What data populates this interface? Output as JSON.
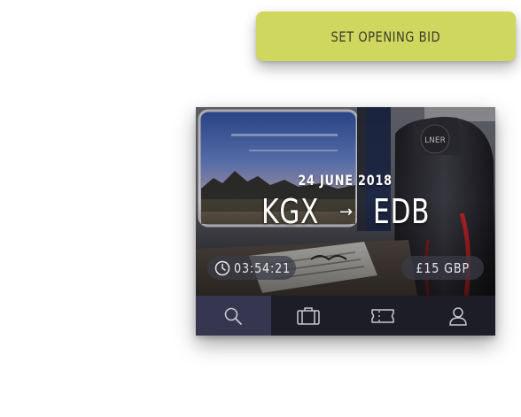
{
  "cta": {
    "label": "SET OPENING BID",
    "color": "#cfd75e"
  },
  "ticket": {
    "date": "24 JUNE 2018",
    "origin": "KGX",
    "destination": "EDB",
    "arrow": "→",
    "time_remaining": "03:54:21",
    "price": "£15 GBP",
    "seat_brand": "LNER"
  },
  "tabbar": {
    "active_tab": "search",
    "tabs": [
      {
        "id": "search",
        "icon": "search-icon"
      },
      {
        "id": "luggage",
        "icon": "suitcase-icon"
      },
      {
        "id": "tickets",
        "icon": "ticket-icon"
      },
      {
        "id": "profile",
        "icon": "user-icon"
      }
    ],
    "active_color": "#363650",
    "bar_color": "#1d1d27"
  }
}
